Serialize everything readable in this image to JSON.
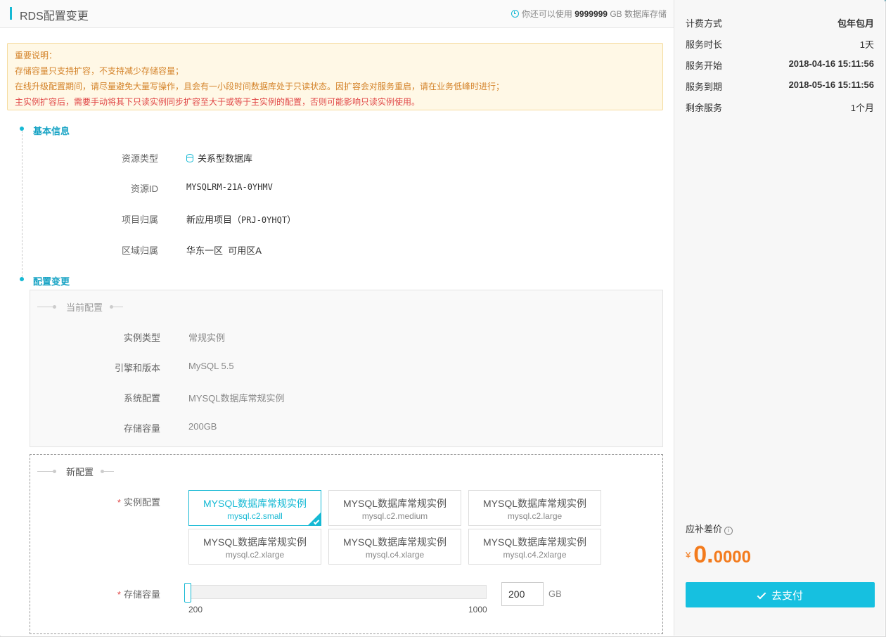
{
  "header": {
    "title": "RDS配置变更",
    "quota_prefix": "你还可以使用",
    "quota_value": "9999999",
    "quota_suffix": "GB 数据库存储"
  },
  "notice": {
    "heading": "重要说明：",
    "line1": "存储容量只支持扩容，不支持减少存储容量；",
    "line2": "在线升级配置期间，请尽量避免大量写操作，且会有一小段时间数据库处于只读状态。因扩容会对服务重启，请在业务低峰时进行；",
    "line3": "主实例扩容后，需要手动将其下只读实例同步扩容至大于或等于主实例的配置，否则可能影响只读实例使用。"
  },
  "basic": {
    "title": "基本信息",
    "resource_type_label": "资源类型",
    "resource_type_value": "关系型数据库",
    "resource_id_label": "资源ID",
    "resource_id_value": "MYSQLRM-21A-0YHMV",
    "project_label": "项目归属",
    "project_name": "新应用项目（",
    "project_code": "PRJ-0YHQT",
    "project_close": "）",
    "region_label": "区域归属",
    "region_value": "华东一区  可用区A"
  },
  "config": {
    "title": "配置变更",
    "current": {
      "legend": "当前配置",
      "instance_type_label": "实例类型",
      "instance_type_value": "常规实例",
      "engine_label": "引擎和版本",
      "engine_value": "MySQL 5.5",
      "system_label": "系统配置",
      "system_value": "MYSQL数据库常规实例",
      "storage_label": "存储容量",
      "storage_value": "200GB"
    },
    "new": {
      "legend": "新配置",
      "instance_label": "实例配置",
      "required_mark": "*",
      "options": [
        {
          "name": "MYSQL数据库常规实例",
          "spec": "mysql.c2.small"
        },
        {
          "name": "MYSQL数据库常规实例",
          "spec": "mysql.c2.medium"
        },
        {
          "name": "MYSQL数据库常规实例",
          "spec": "mysql.c2.large"
        },
        {
          "name": "MYSQL数据库常规实例",
          "spec": "mysql.c2.xlarge"
        },
        {
          "name": "MYSQL数据库常规实例",
          "spec": "mysql.c4.xlarge"
        },
        {
          "name": "MYSQL数据库常规实例",
          "spec": "mysql.c4.2xlarge"
        }
      ],
      "selected_option": "mysql.c2.small",
      "storage_label": "存储容量",
      "slider_min": "200",
      "slider_max": "1000",
      "storage_input": "200",
      "storage_unit": "GB"
    }
  },
  "sidebar": {
    "rows": [
      {
        "key": "计费方式",
        "value": "包年包月"
      },
      {
        "key": "服务时长",
        "value": "1天"
      },
      {
        "key": "服务开始",
        "value": "2018-04-16 15:11:56"
      },
      {
        "key": "服务到期",
        "value": "2018-05-16 15:11:56"
      },
      {
        "key": "剩余服务",
        "value": "1个月"
      }
    ],
    "price_label": "应补差价",
    "info_glyph": "i",
    "currency": "¥",
    "price_int": "0.",
    "price_dec": "0000",
    "pay_button": "去支付"
  },
  "colors": {
    "accent": "#16b9d4",
    "price": "#f37b1d",
    "notice_bg": "#fff8e6",
    "notice_text": "#d4832a",
    "notice_red": "#e04545"
  }
}
